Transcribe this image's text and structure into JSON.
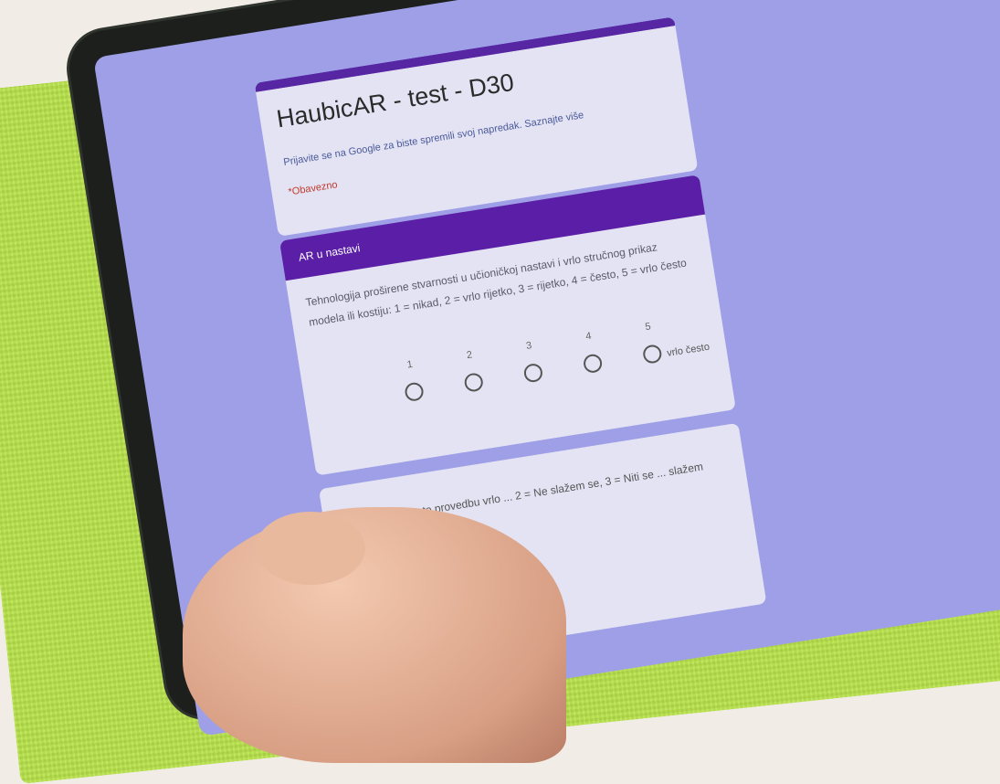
{
  "form": {
    "title": "HaubicAR - test - D30",
    "subtitle": "Prijavite se na Google za biste spremili svoj napredak. Saznajte više",
    "required_note": "*Obavezno",
    "question1": {
      "header": "AR u nastavi",
      "text": "Tehnologija proširene stvarnosti u učioničkoj nastavi i vrlo stručnog prikaz modela ili kostiju: 1 = nikad, 2 = vrlo rijetko, 3 = rijetko, 4 = često, 5 = vrlo često",
      "scale_labels": [
        "1",
        "2",
        "3",
        "4",
        "5"
      ],
      "end_label": "vrlo često"
    },
    "question2": {
      "text": "... razumijevanja te provedbu vrlo ... 2 = Ne slažem se, 3 = Niti se ... slažem"
    }
  },
  "colors": {
    "accent": "#5626a3",
    "screen_bg": "#9e9fe7",
    "towel": "#b8e34a"
  }
}
